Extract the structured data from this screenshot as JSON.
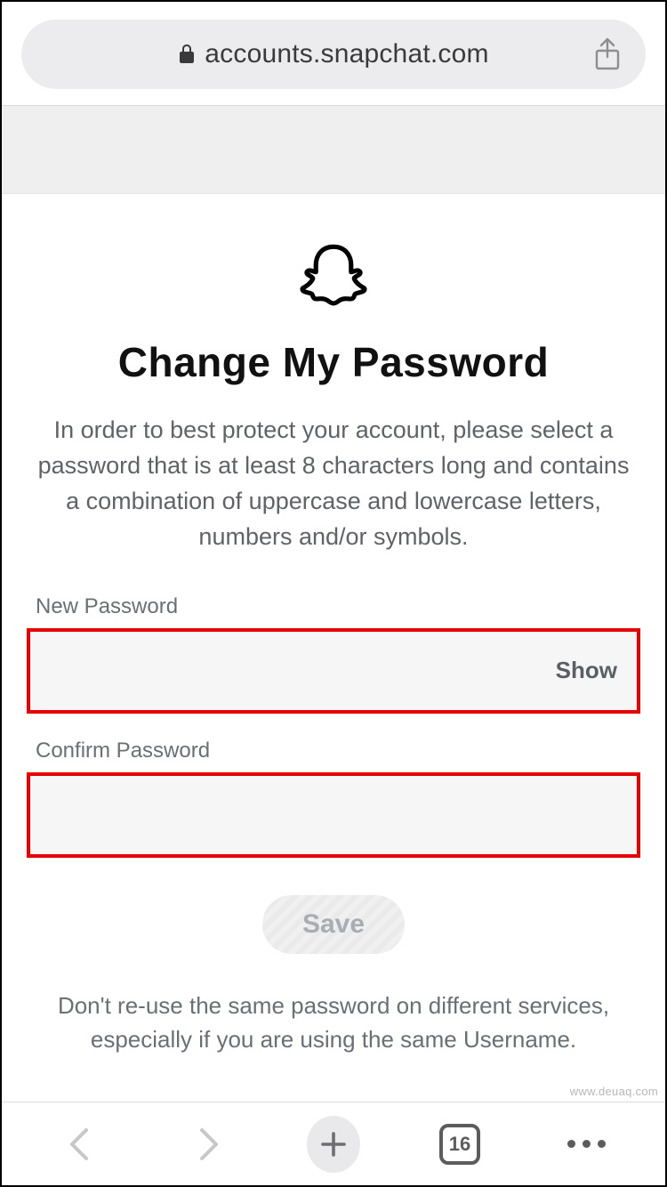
{
  "addressbar": {
    "url": "accounts.snapchat.com"
  },
  "page": {
    "title": "Change My Password",
    "instructions": "In order to best protect your account, please select a password that is at least 8 characters long and contains a combination of uppercase and lowercase letters, numbers and/or symbols."
  },
  "form": {
    "new_password": {
      "label": "New Password",
      "value": "",
      "show_toggle": "Show"
    },
    "confirm_password": {
      "label": "Confirm Password",
      "value": ""
    },
    "save_label": "Save"
  },
  "footer_note": "Don't re-use the same password on different services, especially if you are using the same Username.",
  "bottombar": {
    "tab_count": "16"
  },
  "watermark": "www.deuaq.com"
}
